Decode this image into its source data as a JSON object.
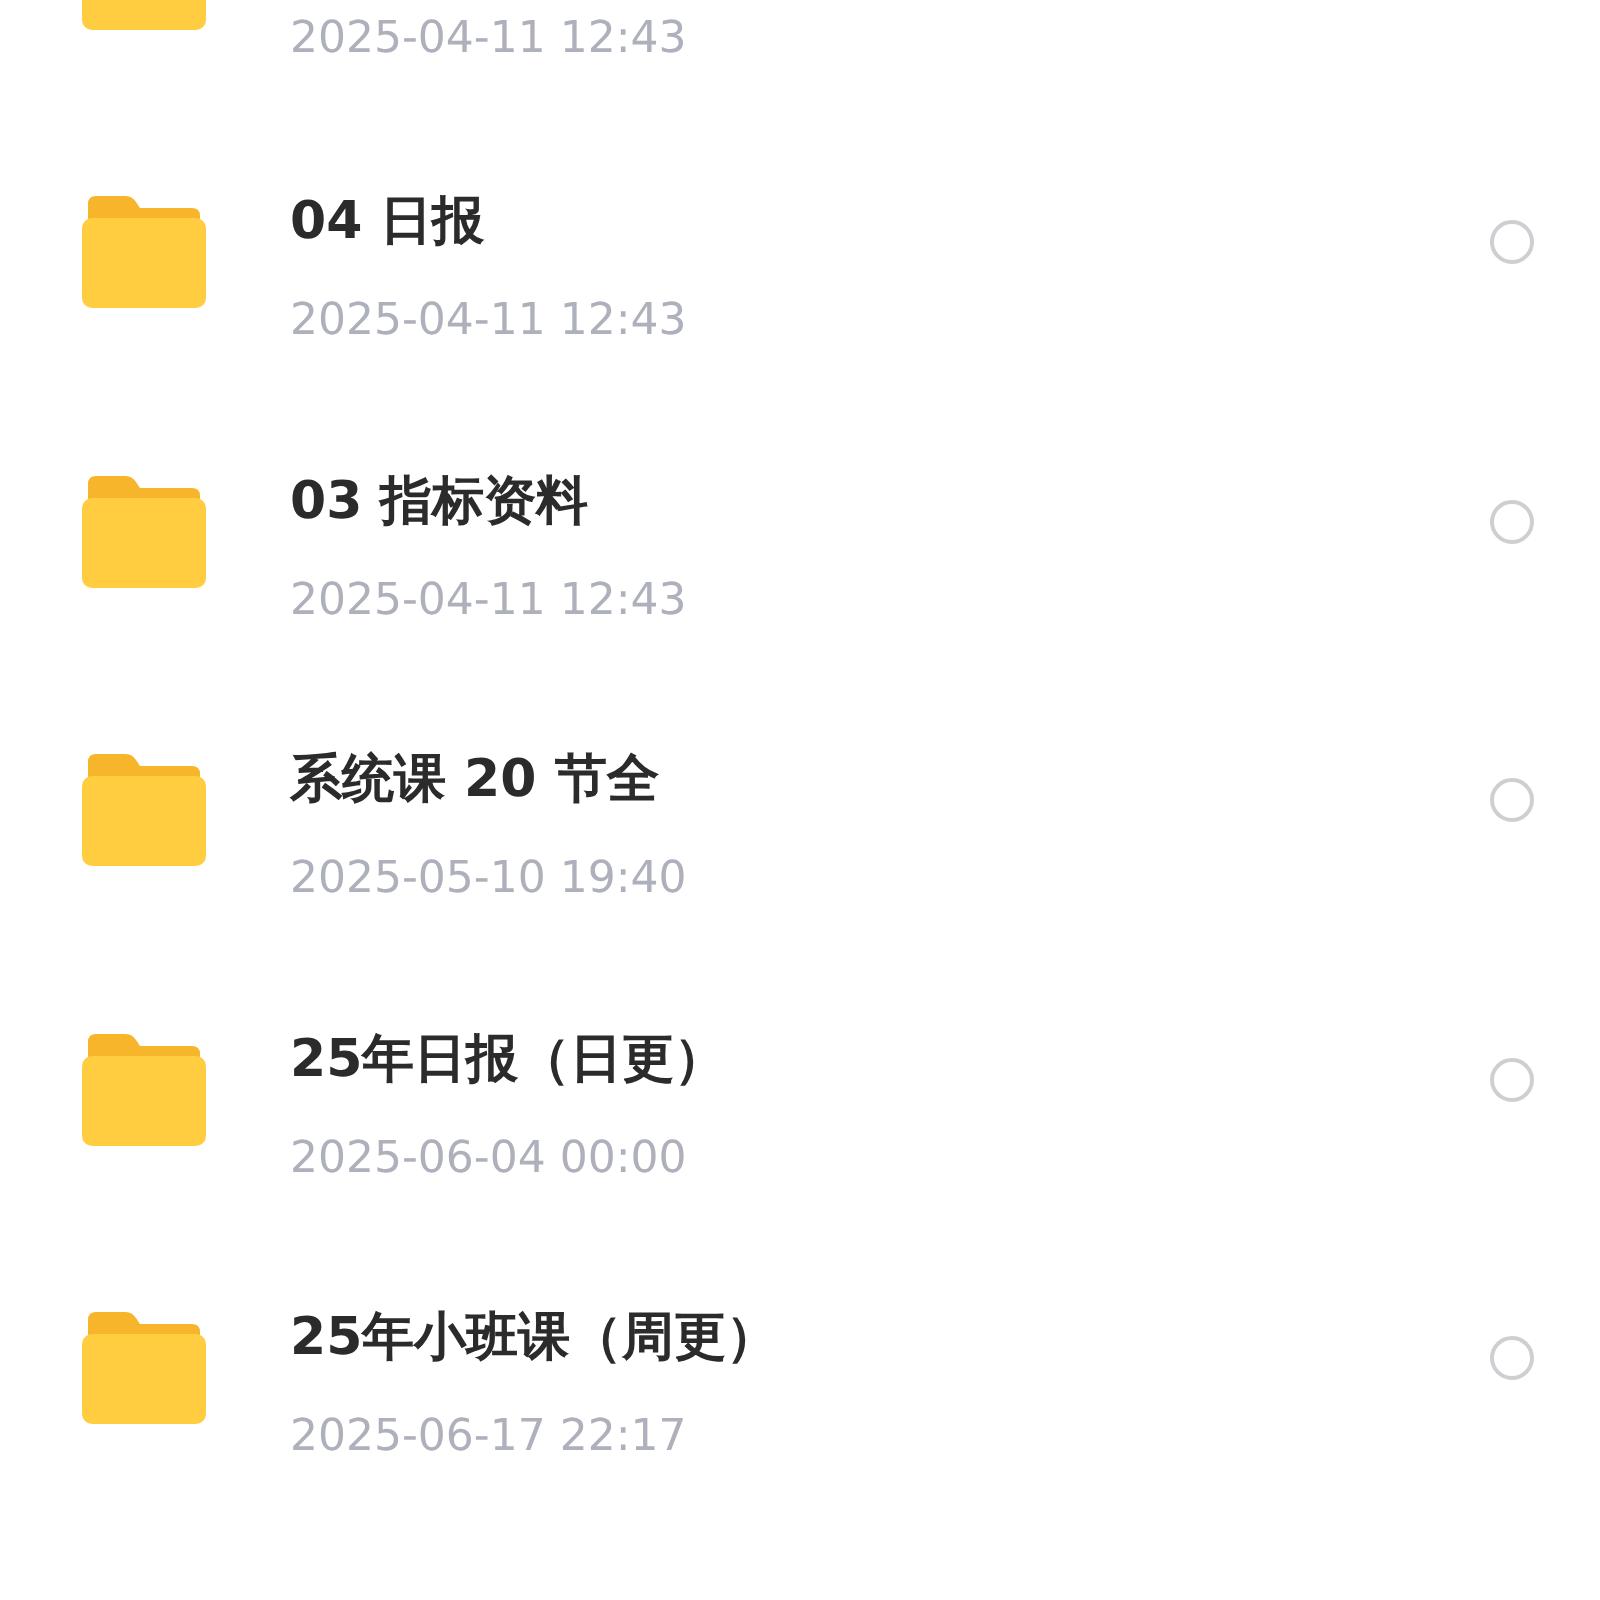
{
  "folders": [
    {
      "date": "2025-04-11 12:43"
    },
    {
      "name": "04 日报",
      "date": "2025-04-11 12:43",
      "selected": false
    },
    {
      "name": "03 指标资料",
      "date": "2025-04-11 12:43",
      "selected": false
    },
    {
      "name": "系统课 20 节全",
      "date": "2025-05-10 19:40",
      "selected": false
    },
    {
      "name": "25年日报（日更）",
      "date": "2025-06-04 00:00",
      "selected": false
    },
    {
      "name": "25年小班课（周更）",
      "date": "2025-06-17 22:17",
      "selected": false
    }
  ]
}
